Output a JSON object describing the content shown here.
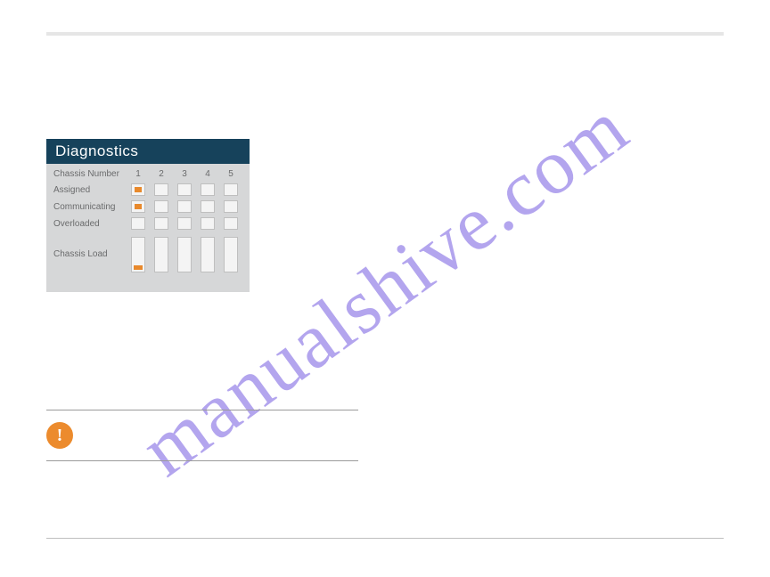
{
  "watermark": "manualshive.com",
  "diagnostics": {
    "title": "Diagnostics",
    "header_row_label": "Chassis Number",
    "columns": [
      "1",
      "2",
      "3",
      "4",
      "5"
    ],
    "rows": [
      {
        "label": "Assigned",
        "lit": [
          true,
          false,
          false,
          false,
          false
        ]
      },
      {
        "label": "Communicating",
        "lit": [
          true,
          false,
          false,
          false,
          false
        ]
      },
      {
        "label": "Overloaded",
        "lit": [
          false,
          false,
          false,
          false,
          false
        ]
      }
    ],
    "load_label": "Chassis Load",
    "load_pct": [
      14,
      0,
      0,
      0,
      0
    ]
  },
  "important": {
    "icon_glyph": "!",
    "text": ""
  }
}
